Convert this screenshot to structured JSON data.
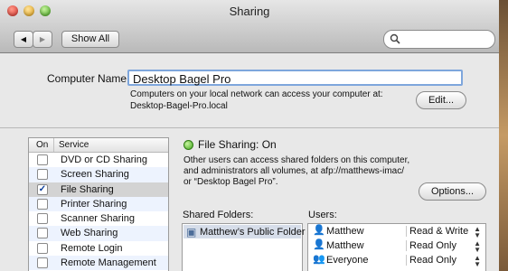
{
  "window": {
    "title": "Sharing"
  },
  "toolbar": {
    "show_all": "Show All",
    "back_glyph": "◀",
    "forward_glyph": "▶",
    "search_placeholder": ""
  },
  "computer_name": {
    "label": "Computer Name:",
    "value": "Desktop Bagel Pro",
    "info_line1": "Computers on your local network can access your computer at:",
    "info_line2": "Desktop-Bagel-Pro.local",
    "edit_button": "Edit..."
  },
  "services": {
    "col_on": "On",
    "col_service": "Service",
    "items": [
      {
        "name": "DVD or CD Sharing",
        "checked": false
      },
      {
        "name": "Screen Sharing",
        "checked": false
      },
      {
        "name": "File Sharing",
        "checked": true,
        "selected": true
      },
      {
        "name": "Printer Sharing",
        "checked": false
      },
      {
        "name": "Scanner Sharing",
        "checked": false
      },
      {
        "name": "Web Sharing",
        "checked": false
      },
      {
        "name": "Remote Login",
        "checked": false
      },
      {
        "name": "Remote Management",
        "checked": false
      }
    ]
  },
  "detail": {
    "status": "File Sharing: On",
    "desc1": "Other users can access shared folders on this computer,",
    "desc2": "and administrators all volumes, at afp://matthews-imac/",
    "desc3": "or “Desktop Bagel Pro”.",
    "options_button": "Options...",
    "shared_folders_label": "Shared Folders:",
    "users_label": "Users:",
    "folders": [
      "Matthew’s Public Folder"
    ],
    "users": [
      {
        "name": "Matthew",
        "perm": "Read & Write"
      },
      {
        "name": "Matthew",
        "perm": "Read Only"
      },
      {
        "name": "Everyone",
        "perm": "Read Only"
      }
    ]
  },
  "colors": {
    "accent": "#7ea6dc",
    "status_on": "#3fa51b",
    "selected_row": "#d3d3d3"
  }
}
